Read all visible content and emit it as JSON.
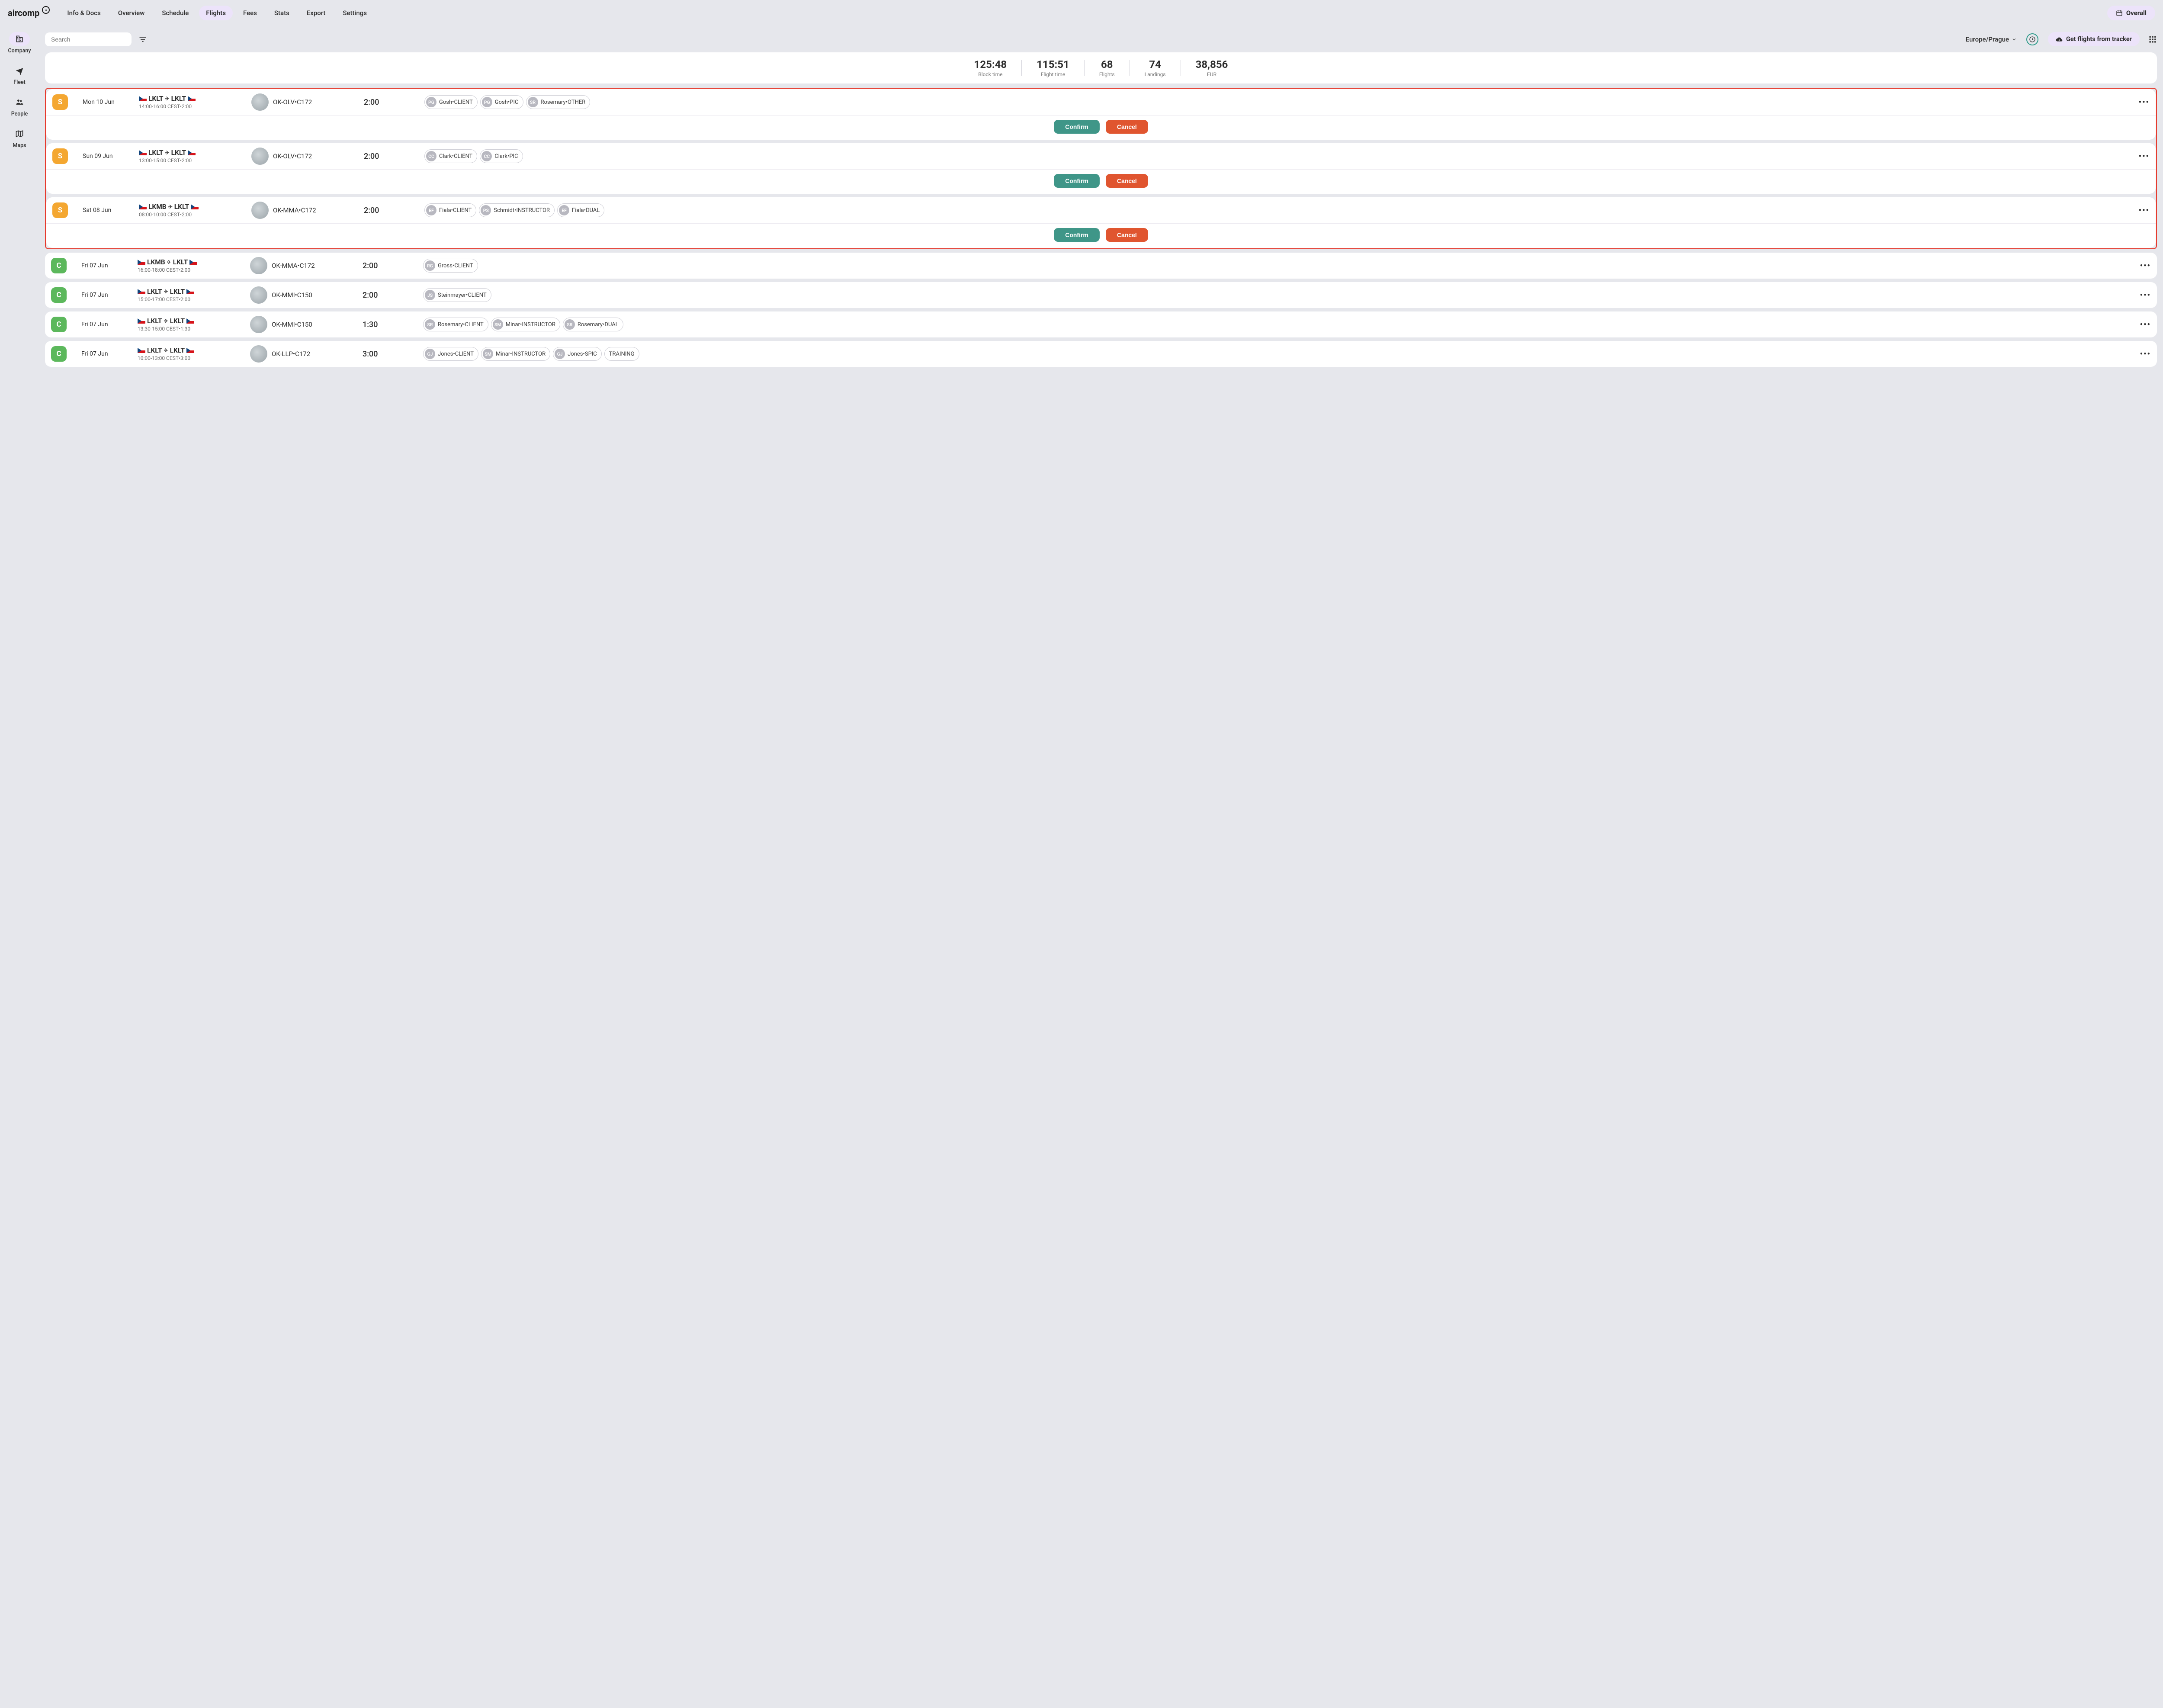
{
  "brand": "aircomp",
  "topnav": {
    "items": [
      "Info & Docs",
      "Overview",
      "Schedule",
      "Flights",
      "Fees",
      "Stats",
      "Export",
      "Settings"
    ],
    "active": "Flights"
  },
  "overall_btn": "Overall",
  "sidebar": {
    "items": [
      {
        "key": "company",
        "label": "Company"
      },
      {
        "key": "fleet",
        "label": "Fleet"
      },
      {
        "key": "people",
        "label": "People"
      },
      {
        "key": "maps",
        "label": "Maps"
      }
    ],
    "active": "company"
  },
  "toolbar": {
    "search_placeholder": "Search",
    "timezone": "Europe/Prague",
    "tracker_btn": "Get flights from tracker"
  },
  "stats": [
    {
      "val": "125:48",
      "lbl": "Block time"
    },
    {
      "val": "115:51",
      "lbl": "Flight time"
    },
    {
      "val": "68",
      "lbl": "Flights"
    },
    {
      "val": "74",
      "lbl": "Landings"
    },
    {
      "val": "38,856",
      "lbl": "EUR"
    }
  ],
  "buttons": {
    "confirm": "Confirm",
    "cancel": "Cancel"
  },
  "flights": [
    {
      "status": "S",
      "date": "Mon 10 Jun",
      "from": "LKLT",
      "to": "LKLT",
      "time_sub": "14:00-16:00 CEST•2:00",
      "aircraft": "OK-OLV•C172",
      "duration": "2:00",
      "chips": [
        {
          "i": "PG",
          "t": "Gosh•CLIENT"
        },
        {
          "i": "PG",
          "t": "Gosh•PIC"
        },
        {
          "i": "SR",
          "t": "Rosemary•OTHER"
        }
      ],
      "actions": true
    },
    {
      "status": "S",
      "date": "Sun 09 Jun",
      "from": "LKLT",
      "to": "LKLT",
      "time_sub": "13:00-15:00 CEST•2:00",
      "aircraft": "OK-OLV•C172",
      "duration": "2:00",
      "chips": [
        {
          "i": "CC",
          "t": "Clark•CLIENT"
        },
        {
          "i": "CC",
          "t": "Clark•PIC"
        }
      ],
      "actions": true
    },
    {
      "status": "S",
      "date": "Sat 08 Jun",
      "from": "LKMB",
      "to": "LKLT",
      "time_sub": "08:00-10:00 CEST•2:00",
      "aircraft": "OK-MMA•C172",
      "duration": "2:00",
      "chips": [
        {
          "i": "EF",
          "t": "Fiala•CLIENT"
        },
        {
          "i": "PS",
          "t": "Schmidt•INSTRUCTOR"
        },
        {
          "i": "EF",
          "t": "Fiala•DUAL"
        }
      ],
      "actions": true
    },
    {
      "status": "C",
      "date": "Fri 07 Jun",
      "from": "LKMB",
      "to": "LKLT",
      "time_sub": "16:00-18:00 CEST•2:00",
      "aircraft": "OK-MMA•C172",
      "duration": "2:00",
      "chips": [
        {
          "i": "RG",
          "t": "Gross•CLIENT"
        }
      ],
      "actions": false
    },
    {
      "status": "C",
      "date": "Fri 07 Jun",
      "from": "LKLT",
      "to": "LKLT",
      "time_sub": "15:00-17:00 CEST•2:00",
      "aircraft": "OK-MMI•C150",
      "duration": "2:00",
      "chips": [
        {
          "i": "JS",
          "t": "Steinmayer•CLIENT"
        }
      ],
      "actions": false
    },
    {
      "status": "C",
      "date": "Fri 07 Jun",
      "from": "LKLT",
      "to": "LKLT",
      "time_sub": "13:30-15:00 CEST•1:30",
      "aircraft": "OK-MMI•C150",
      "duration": "1:30",
      "chips": [
        {
          "i": "SR",
          "t": "Rosemary•CLIENT"
        },
        {
          "i": "SM",
          "t": "Minar•INSTRUCTOR"
        },
        {
          "i": "SR",
          "t": "Rosemary•DUAL"
        }
      ],
      "actions": false
    },
    {
      "status": "C",
      "date": "Fri 07 Jun",
      "from": "LKLT",
      "to": "LKLT",
      "time_sub": "10:00-13:00 CEST•3:00",
      "aircraft": "OK-LLP•C172",
      "duration": "3:00",
      "chips": [
        {
          "i": "GJ",
          "t": "Jones•CLIENT"
        },
        {
          "i": "SM",
          "t": "Minar•INSTRUCTOR"
        },
        {
          "i": "GJ",
          "t": "Jones•SPIC"
        },
        {
          "i": "",
          "t": "TRAINING",
          "plain": true
        }
      ],
      "actions": false
    }
  ]
}
